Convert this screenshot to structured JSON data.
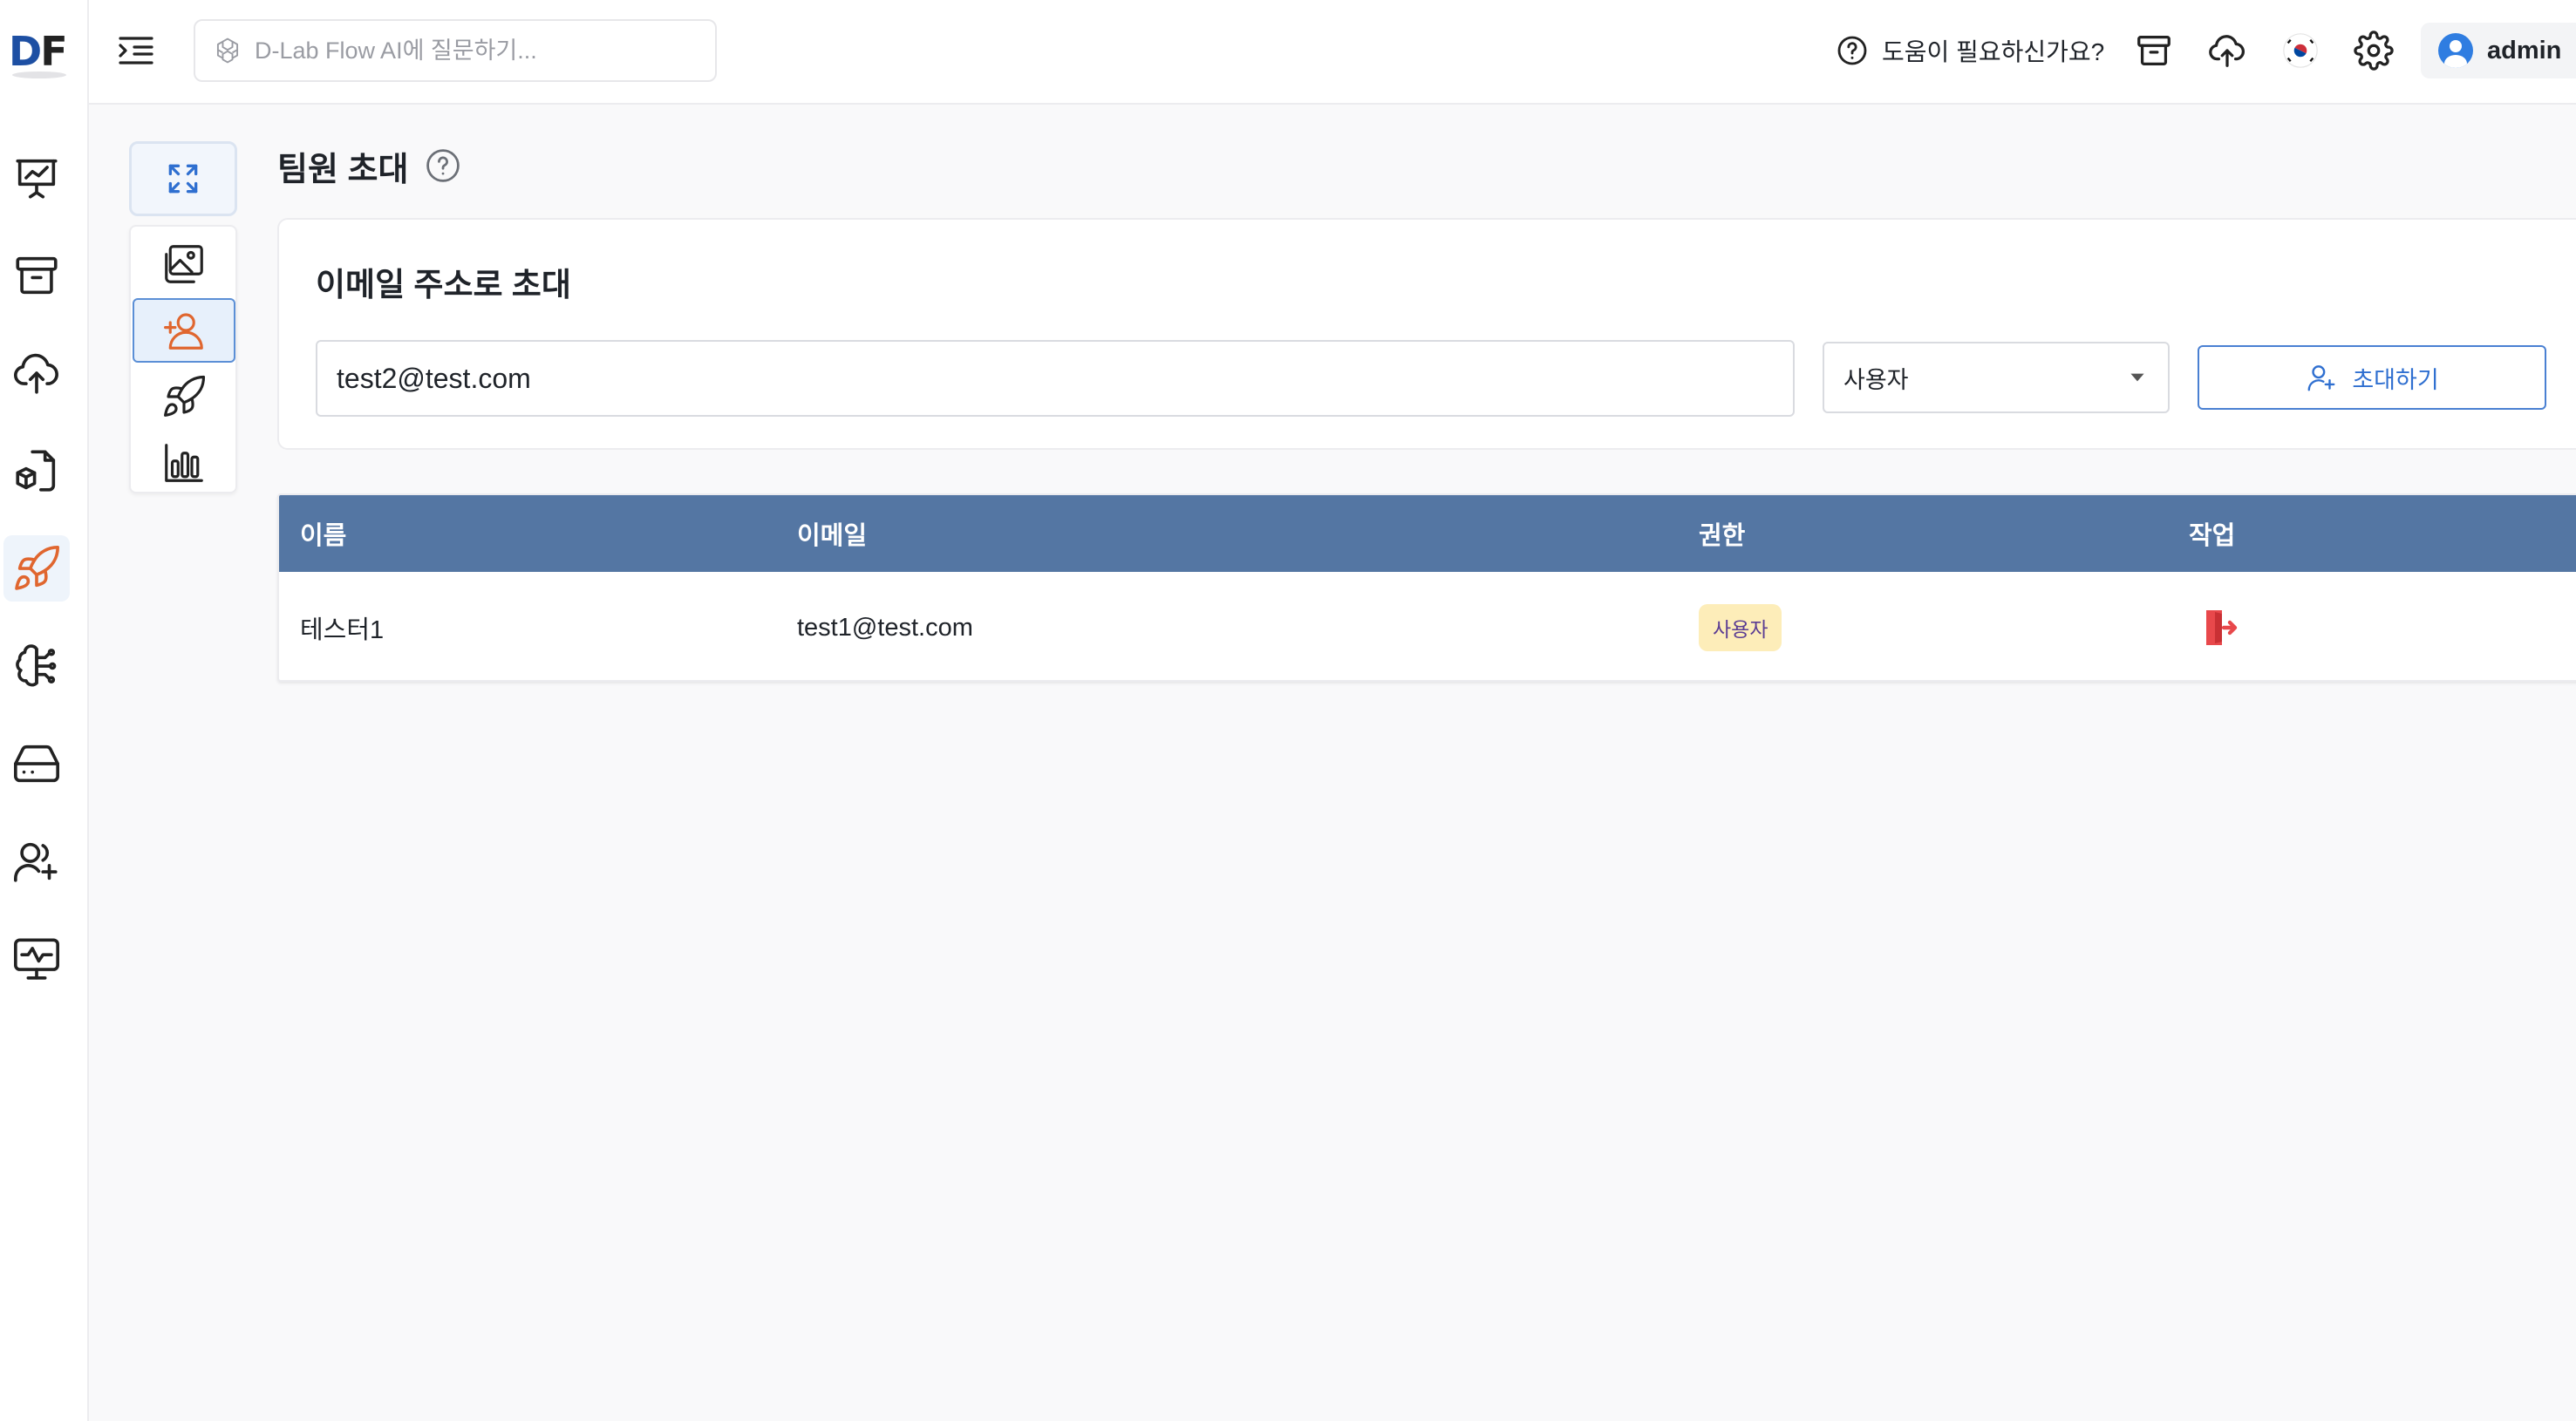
{
  "brand": {
    "logo_d": "D",
    "logo_f": "F"
  },
  "topbar": {
    "search_placeholder": "D-Lab Flow AI에 질문하기...",
    "help_label": "도움이 필요하신가요?",
    "username": "admin"
  },
  "rail": {
    "items": [
      {
        "icon": "presentation-chart-icon",
        "active": false
      },
      {
        "icon": "archive-box-icon",
        "active": false
      },
      {
        "icon": "cloud-upload-icon",
        "active": false
      },
      {
        "icon": "document-cube-icon",
        "active": false
      },
      {
        "icon": "rocket-icon",
        "active": true
      },
      {
        "icon": "brain-icon",
        "active": false
      },
      {
        "icon": "hard-drive-icon",
        "active": false
      },
      {
        "icon": "user-plus-icon",
        "active": false
      },
      {
        "icon": "monitor-pulse-icon",
        "active": false
      }
    ]
  },
  "tools": {
    "items": [
      {
        "icon": "image-gallery-icon",
        "active": false
      },
      {
        "icon": "user-add-icon",
        "active": true
      },
      {
        "icon": "rocket-icon",
        "active": false
      },
      {
        "icon": "bar-chart-icon",
        "active": false
      }
    ]
  },
  "page": {
    "title": "팀원 초대"
  },
  "invite": {
    "heading": "이메일 주소로 초대",
    "email_value": "test2@test.com",
    "role_selected": "사용자",
    "button_label": "초대하기"
  },
  "members_table": {
    "columns": [
      "이름",
      "이메일",
      "권한",
      "작업"
    ],
    "rows": [
      {
        "name": "테스터1",
        "email": "test1@test.com",
        "role": "사용자"
      }
    ]
  },
  "colors": {
    "accent": "#2f6fd0",
    "header_row": "#5476a3",
    "active_icon": "#e0662f",
    "badge_bg": "#fdedb9",
    "danger": "#e8484b"
  }
}
